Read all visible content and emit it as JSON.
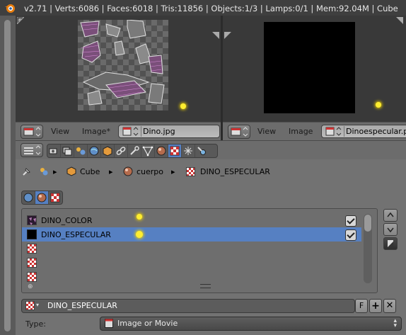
{
  "info_bar": {
    "status": "v2.71 | Verts:6086 | Faces:6018 | Tris:11856 | Objects:1/3 | Lamps:0/1 | Mem:92.04M | Cube"
  },
  "image_editor_left": {
    "menu_view": "View",
    "menu_image": "Image*",
    "image_name": "Dino.jpg"
  },
  "image_editor_right": {
    "menu_view": "View",
    "menu_image": "Image",
    "image_name": "Dinoespecular.pn"
  },
  "breadcrumb": {
    "object": "Cube",
    "material": "cuerpo",
    "texture": "DINO_ESPECULAR"
  },
  "texture_slots": [
    {
      "name": "DINO_COLOR",
      "thumb": "color-map",
      "enabled": true,
      "selected": false
    },
    {
      "name": "DINO_ESPECULAR",
      "thumb": "black",
      "enabled": true,
      "selected": true
    },
    {
      "name": "",
      "thumb": "empty-checker",
      "enabled": false,
      "selected": false
    },
    {
      "name": "",
      "thumb": "empty-checker",
      "enabled": false,
      "selected": false
    },
    {
      "name": "",
      "thumb": "empty-checker",
      "enabled": false,
      "selected": false
    }
  ],
  "texture_datablock": {
    "name": "DINO_ESPECULAR",
    "fake_user": "F"
  },
  "type_row": {
    "label": "Type:",
    "value": "Image or Movie"
  },
  "colors": {
    "selection": "#5680c2",
    "lamp": "#ffee30"
  }
}
